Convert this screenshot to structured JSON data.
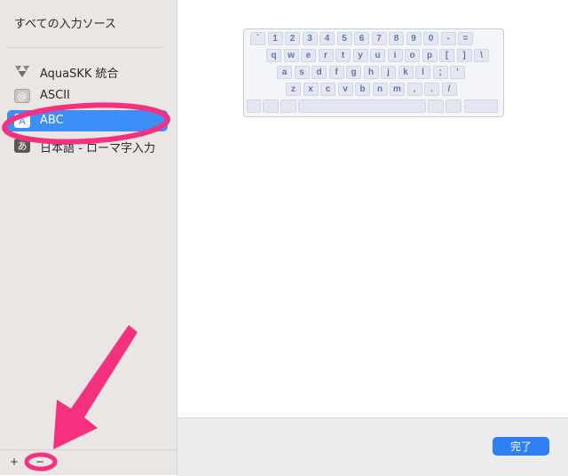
{
  "sidebar": {
    "title": "すべての入力ソース",
    "items": [
      {
        "label": "AquaSKK 統合",
        "icon": "aquaskk-icon"
      },
      {
        "label": "ASCII",
        "icon": "at-icon",
        "icon_text": "@"
      },
      {
        "label": "ABC",
        "icon": "a-icon",
        "icon_text": "A",
        "selected": true
      },
      {
        "label": "日本語 - ローマ字入力",
        "icon": "kana-icon",
        "icon_text": "あ"
      }
    ],
    "add_label": "+",
    "remove_label": "−"
  },
  "keyboard": {
    "rows": [
      [
        "`",
        "1",
        "2",
        "3",
        "4",
        "5",
        "6",
        "7",
        "8",
        "9",
        "0",
        "-",
        "="
      ],
      [
        "q",
        "w",
        "e",
        "r",
        "t",
        "y",
        "u",
        "i",
        "o",
        "p",
        "[",
        "]",
        "\\"
      ],
      [
        "a",
        "s",
        "d",
        "f",
        "g",
        "h",
        "j",
        "k",
        "l",
        ";",
        "'"
      ],
      [
        "z",
        "x",
        "c",
        "v",
        "b",
        "n",
        "m",
        ",",
        ".",
        "/"
      ]
    ]
  },
  "footer": {
    "done_label": "完了"
  },
  "colors": {
    "accent": "#3d8ef7",
    "button": "#2f7ef3",
    "annotation": "#f5317f",
    "key_text": "#5e79ad"
  }
}
